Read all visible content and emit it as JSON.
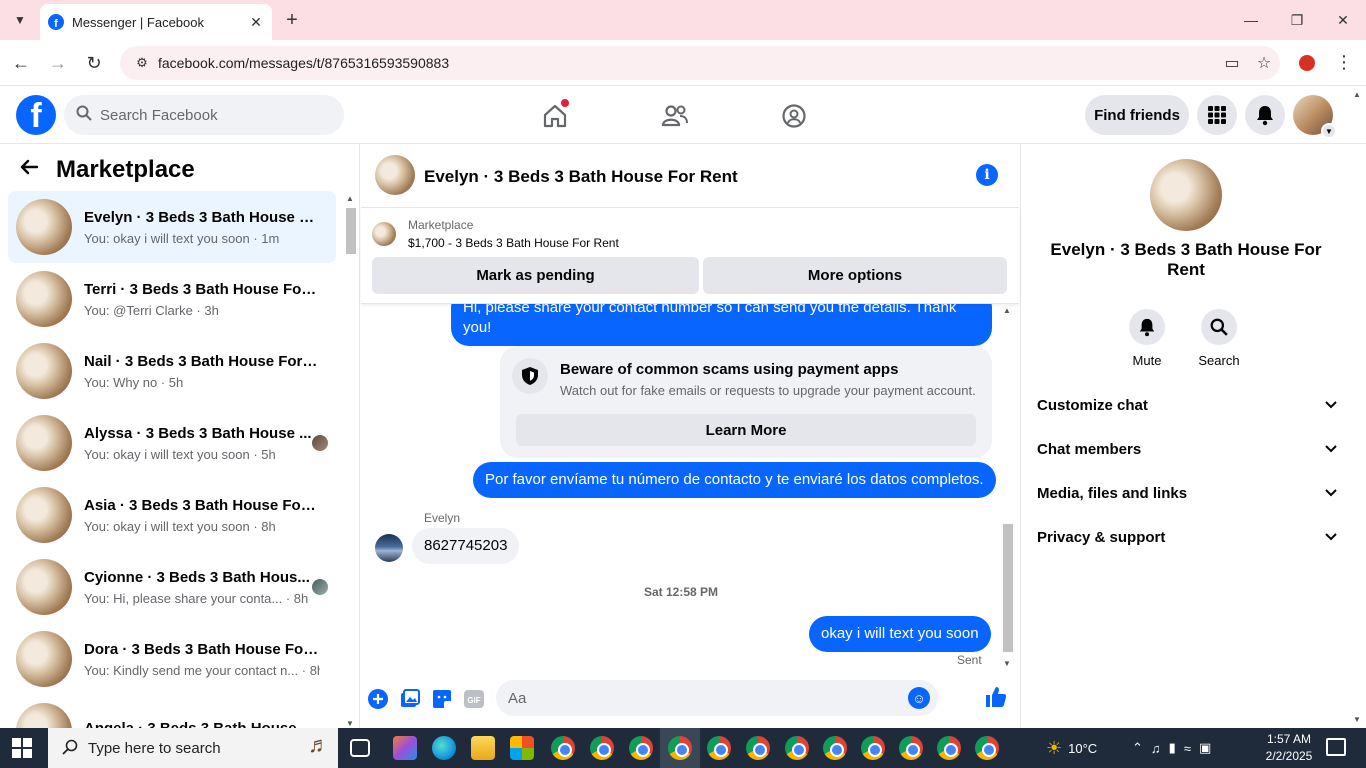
{
  "browser": {
    "tab_title": "Messenger | Facebook",
    "url": "facebook.com/messages/t/8765316593590883",
    "favicon_letter": "f"
  },
  "fb_nav": {
    "logo_letter": "f",
    "search_placeholder": "Search Facebook",
    "find_friends_label": "Find friends"
  },
  "left_panel": {
    "title": "Marketplace",
    "conversations": [
      {
        "name": "Evelyn · 3 Beds 3 Bath House Fo...",
        "last": "You: okay i will text you soon · 1m",
        "active": true
      },
      {
        "name": "Terri · 3 Beds 3 Bath House For ...",
        "last": "You: @Terri Clarke · 3h"
      },
      {
        "name": "Nail · 3 Beds 3 Bath House For R...",
        "last": "You: Why no · 5h"
      },
      {
        "name": "Alyssa · 3 Beds 3 Bath House ...",
        "last": "You: okay i will text you soon · 5h"
      },
      {
        "name": "Asia · 3 Beds 3 Bath House For ...",
        "last": "You: okay i will text you soon · 8h"
      },
      {
        "name": "Cyionne · 3 Beds 3 Bath Hous...",
        "last": "You: Hi, please share your conta... · 8h"
      },
      {
        "name": "Dora · 3 Beds 3 Bath House For ...",
        "last": "You: Kindly send me your contact n... · 8h"
      },
      {
        "name": "Angela · 3 Beds 3 Bath House...",
        "last": ""
      }
    ]
  },
  "chat": {
    "title": "Evelyn · 3 Beds 3 Bath House For Rent",
    "listing_source": "Marketplace",
    "listing_price_title": "$1,700 - 3 Beds 3 Bath House For Rent",
    "mark_pending_label": "Mark as pending",
    "more_options_label": "More options",
    "msg_out_1": "Hi, please share your contact number so I can send you the details. Thank you!",
    "safety_title": "Beware of common scams using payment apps",
    "safety_desc": "Watch out for fake emails or requests to upgrade your payment account.",
    "learn_more_label": "Learn More",
    "msg_out_2": "Por favor envíame tu número de contacto y te enviaré los datos completos.",
    "sender_name": "Evelyn",
    "msg_in_1": "8627745203",
    "timestamp": "Sat 12:58 PM",
    "msg_out_3": "okay i will text you soon",
    "sent_status": "Sent",
    "composer_placeholder": "Aa"
  },
  "right_panel": {
    "name": "Evelyn · 3 Beds 3 Bath House For Rent",
    "mute_label": "Mute",
    "search_label": "Search",
    "sections": [
      "Customize chat",
      "Chat members",
      "Media, files and links",
      "Privacy & support"
    ]
  },
  "taskbar": {
    "search_placeholder": "Type here to search",
    "temperature": "10°C",
    "time": "1:57 AM",
    "date": "2/2/2025"
  },
  "colors": {
    "accent": "#0866ff",
    "bubble_in": "#f0f2f5",
    "tabbar": "#fcdfe5",
    "taskbar": "#1f2b3a"
  }
}
